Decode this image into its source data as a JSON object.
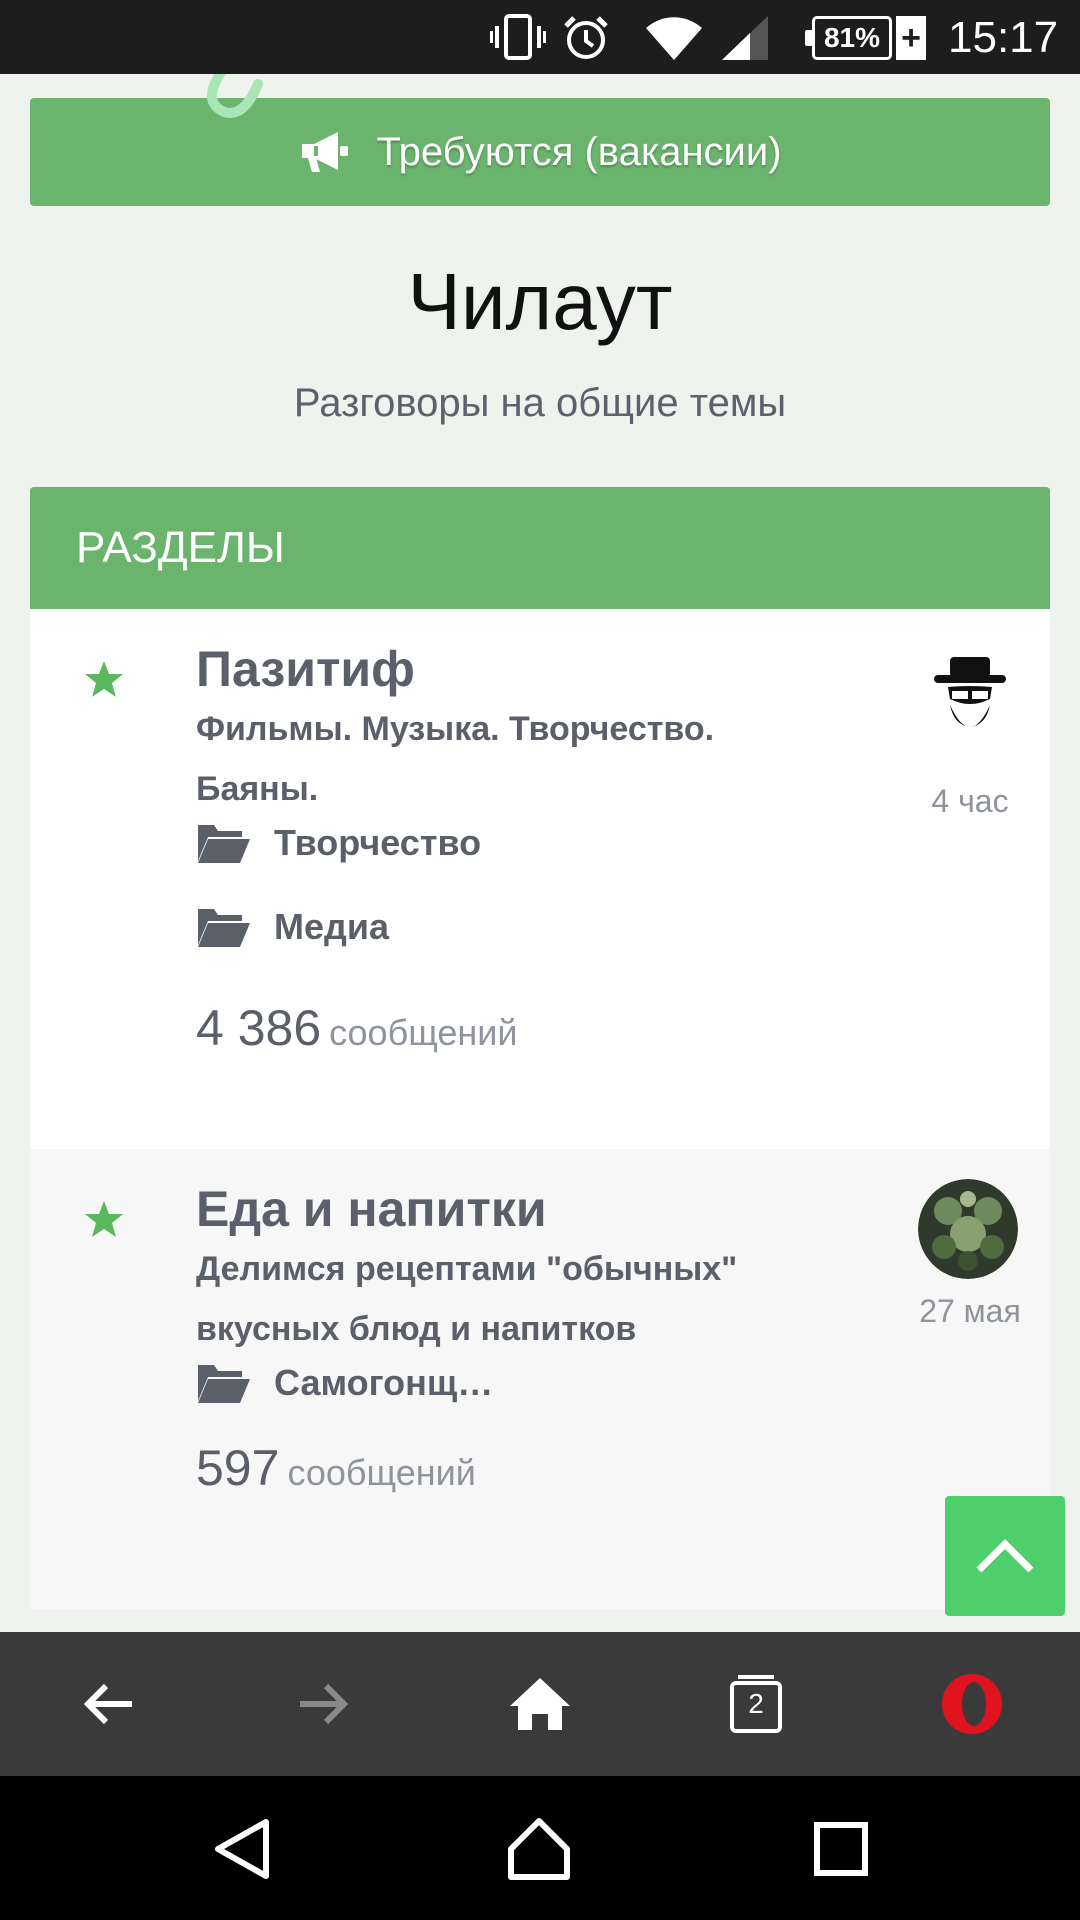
{
  "status_bar": {
    "battery": "81%",
    "time": "15:17",
    "icons": [
      "vibrate-icon",
      "alarm-icon",
      "wifi-icon",
      "signal-icon",
      "battery-icon",
      "charging-icon"
    ]
  },
  "vacancies_button": {
    "label": "Требуются (вакансии)",
    "icon": "megaphone-icon"
  },
  "page": {
    "title": "Чилаут",
    "subtitle": "Разговоры на общие темы"
  },
  "sections": {
    "header": "РАЗДЕЛЫ",
    "forums": [
      {
        "title": "Пазитиф",
        "description": "Фильмы. Музыка. Творчество. Баяны.",
        "subforums": [
          "Творчество",
          "Медиа"
        ],
        "message_count": "4 386",
        "message_label": "сообщений",
        "last_post_time": "4 час"
      },
      {
        "title": "Еда и напитки",
        "description": "Делимся рецептами \"обычных\" вкусных блюд и напитков",
        "subforums": [
          "Самогонщ…"
        ],
        "message_count": "597",
        "message_label": "сообщений",
        "last_post_time": "27 мая"
      }
    ]
  },
  "browser_bar": {
    "tab_count": "2",
    "icons": [
      "back-arrow-icon",
      "forward-arrow-icon",
      "home-icon",
      "tabs-icon",
      "opera-icon"
    ]
  },
  "nav_bar": {
    "icons": [
      "nav-back-icon",
      "nav-home-icon",
      "nav-recents-icon"
    ]
  },
  "colors": {
    "accent_green": "#6ab46d",
    "scroll_top_green": "#4fcf6c",
    "page_bg": "#eef3ee",
    "text_gray": "#5b5f6a"
  }
}
